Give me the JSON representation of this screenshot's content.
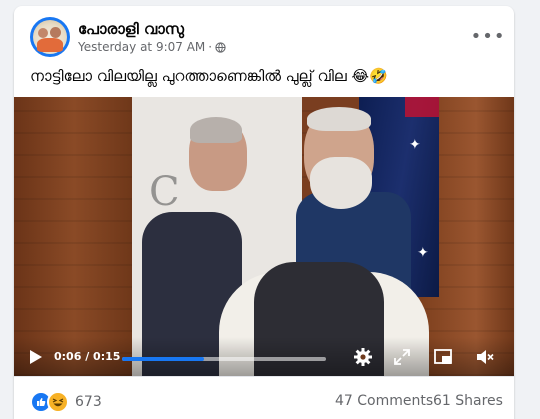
{
  "post": {
    "page_name": "പോരാളി വാസു",
    "timestamp": "Yesterday at 9:07 AM",
    "separator": "·",
    "privacy_icon": "globe-icon",
    "more_icon": "more-options-icon",
    "more_label": "•••",
    "caption": "നാട്ടിലോ വിലയില്ല പുറത്താണെങ്കിൽ പുല്ല് വില 😂🤣"
  },
  "video": {
    "current_time": "0:06",
    "duration": "0:15",
    "time_display": "0:06 / 0:15",
    "progress_fraction": 0.4,
    "controls": [
      "play-icon",
      "settings-gear-icon",
      "fullscreen-icon",
      "picture-in-picture-icon",
      "mute-icon"
    ]
  },
  "engagement": {
    "reaction_icons": [
      "like-reaction-icon",
      "haha-reaction-icon"
    ],
    "reaction_count": "673",
    "comments": "47 Comments",
    "shares": "61 Shares"
  },
  "colors": {
    "brand_blue": "#1877f2",
    "text_primary": "#050505",
    "text_secondary": "#65676b",
    "background": "#f0f2f5"
  }
}
